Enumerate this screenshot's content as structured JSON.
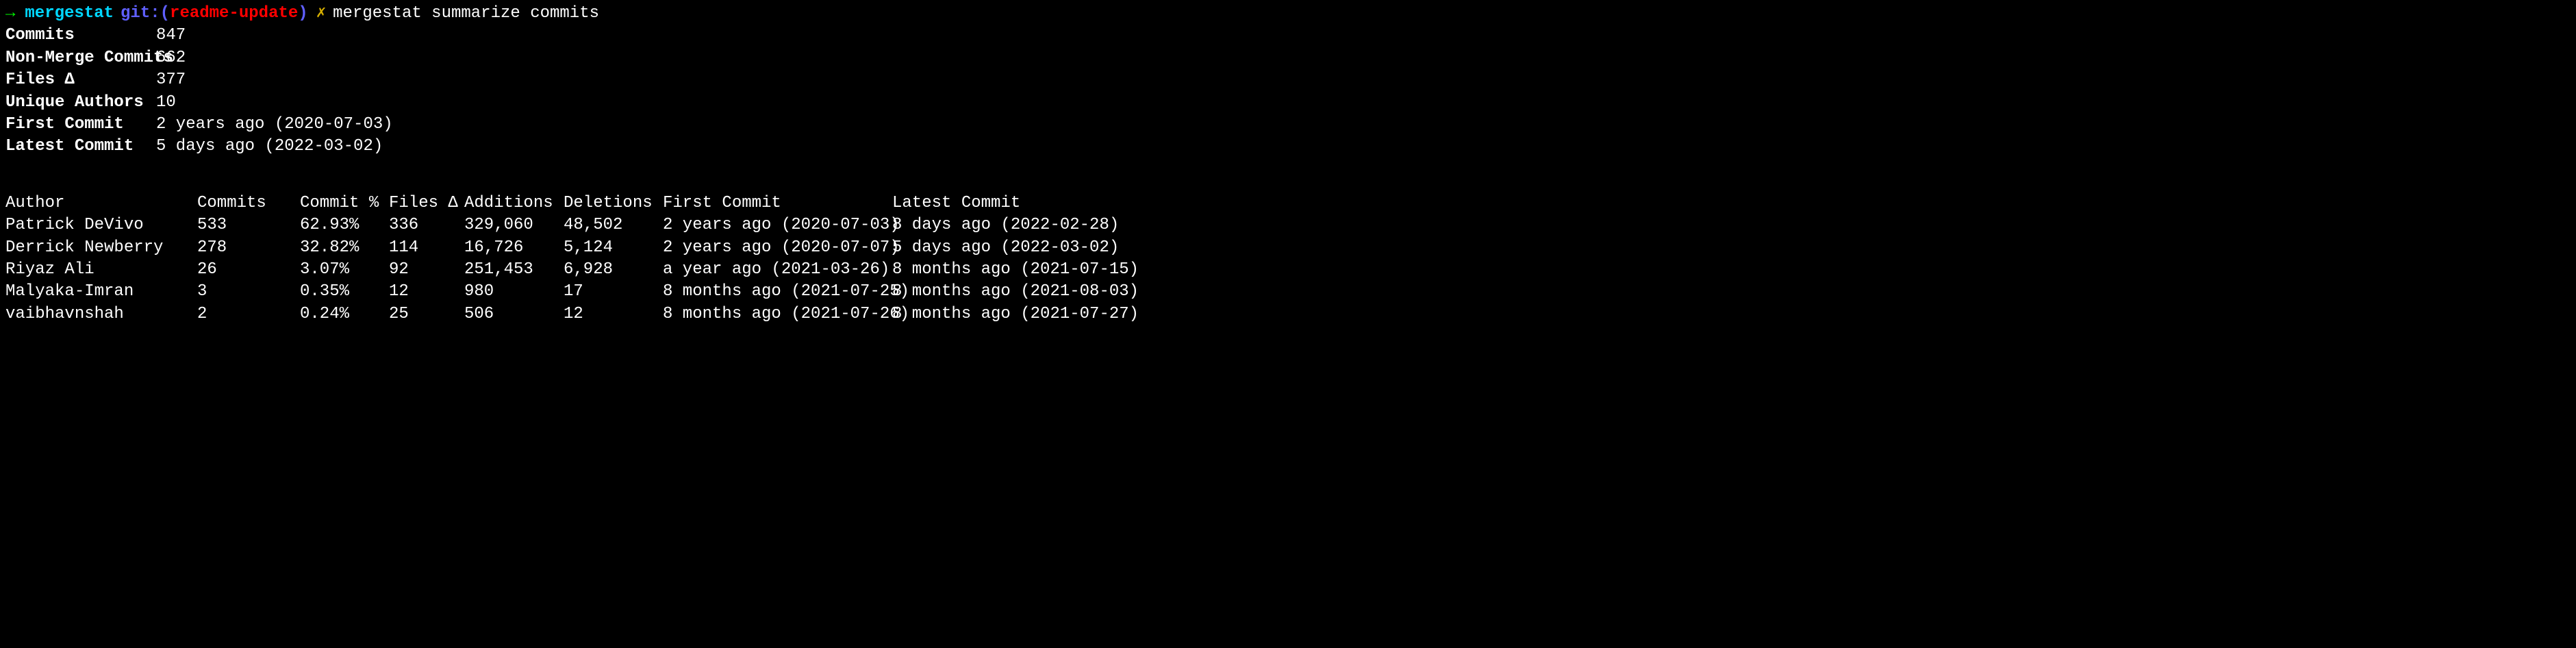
{
  "prompt": {
    "arrow": "→",
    "dir": "mergestat",
    "git_label": "git:(",
    "git_branch": "readme-update",
    "git_close": ")",
    "separator": "✗",
    "command": "mergestat summarize commits"
  },
  "summary": {
    "rows": [
      {
        "label": "Commits",
        "value": "847"
      },
      {
        "label": "Non-Merge Commits",
        "value": "662"
      },
      {
        "label": "Files Δ",
        "value": "377"
      },
      {
        "label": "Unique Authors",
        "value": "10"
      },
      {
        "label": "First Commit",
        "value": "2 years ago (2020-07-03)"
      },
      {
        "label": "Latest Commit",
        "value": "5 days ago (2022-03-02)"
      }
    ]
  },
  "table": {
    "headers": {
      "author": "Author",
      "commits": "Commits",
      "pct": "Commit %",
      "files": "Files Δ",
      "additions": "Additions",
      "deletions": "Deletions",
      "first": "First Commit",
      "latest": "Latest Commit"
    },
    "rows": [
      {
        "author": "Patrick DeVivo",
        "commits": "533",
        "pct": "62.93%",
        "files": "336",
        "additions": "329,060",
        "deletions": "48,502",
        "first": "2 years ago (2020-07-03)",
        "latest": "8 days ago (2022-02-28)"
      },
      {
        "author": "Derrick Newberry",
        "commits": "278",
        "pct": "32.82%",
        "files": "114",
        "additions": "16,726",
        "deletions": "5,124",
        "first": "2 years ago (2020-07-07)",
        "latest": "5 days ago (2022-03-02)"
      },
      {
        "author": "Riyaz Ali",
        "commits": "26",
        "pct": "3.07%",
        "files": "92",
        "additions": "251,453",
        "deletions": "6,928",
        "first": "a year ago (2021-03-26)",
        "latest": "8 months ago (2021-07-15)"
      },
      {
        "author": "Malyaka-Imran",
        "commits": "3",
        "pct": "0.35%",
        "files": "12",
        "additions": "980",
        "deletions": "17",
        "first": "8 months ago (2021-07-25)",
        "latest": "8 months ago (2021-08-03)"
      },
      {
        "author": "vaibhavnshah",
        "commits": "2",
        "pct": "0.24%",
        "files": "25",
        "additions": "506",
        "deletions": "12",
        "first": "8 months ago (2021-07-26)",
        "latest": "8 months ago (2021-07-27)"
      }
    ]
  }
}
